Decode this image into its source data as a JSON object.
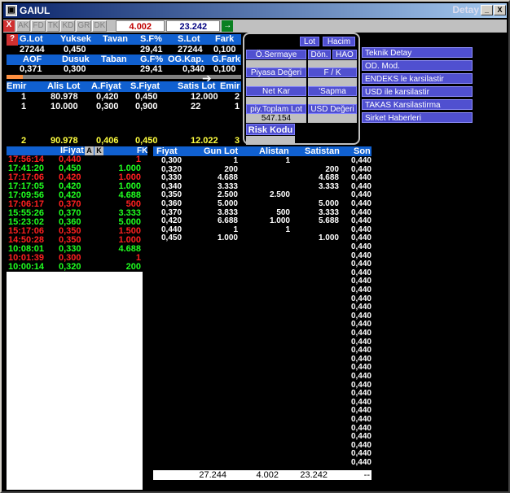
{
  "window": {
    "title": "GAIUL",
    "right_title": "Detay",
    "min": "_",
    "close": "X"
  },
  "toolbar": {
    "close": "X",
    "buttons": [
      "AK",
      "FD",
      "TK",
      "KD",
      "GR",
      "DK"
    ],
    "val1": "4.002",
    "val2": "23.242",
    "go": "→"
  },
  "h1": [
    "G.Lot",
    "Yuksek",
    "Tavan",
    "S.F%",
    "S.Lot",
    "Fark"
  ],
  "r1": [
    "27244",
    "0,450",
    "",
    "29,41",
    "27244",
    "0,100"
  ],
  "h2": [
    "AOF",
    "Dusuk",
    "Taban",
    "G.F%",
    "OG.Kap.",
    "G.Fark"
  ],
  "r2": [
    "0,371",
    "0,300",
    "",
    "29,41",
    "0,340",
    "0,100"
  ],
  "h3": [
    "Emir",
    "Alis Lot",
    "A.Fiyat",
    "S.Fiyat",
    "Satis Lot",
    "Emir"
  ],
  "orders": [
    [
      "1",
      "80.978",
      "0,420",
      "0,450",
      "12.000",
      "2"
    ],
    [
      "1",
      "10.000",
      "0,300",
      "0,900",
      "22",
      "1"
    ]
  ],
  "totals": [
    "2",
    "90.978",
    "0,406",
    "0,450",
    "12.022",
    "3"
  ],
  "popup": {
    "lot": "Lot",
    "hacim": "Hacim",
    "osermaye": "Ö.Sermaye",
    "don": "Dön.",
    "hao": "HAO",
    "piyasa": "Piyasa Değeri",
    "fk": "F / K",
    "netkar": "Net Kar",
    "sapma": "'Sapma",
    "piytoplam": "piy.Toplam Lot",
    "piytoplam_val": "547.154",
    "usd": "USD Değeri",
    "risk": "Risk Kodu"
  },
  "side": [
    "Teknik Detay",
    "OD. Mod.",
    "ENDEKS le karsilastir",
    "USD ile karsilastir",
    "TAKAS Karsilastirma",
    "Sirket Haberleri"
  ],
  "left_head": {
    "fiyat": "IFiyat",
    "a": "A",
    "k": "K",
    "fk": "FK"
  },
  "trades": [
    {
      "t": "17:56:14",
      "p": "0,440",
      "q": "1",
      "c": "red"
    },
    {
      "t": "17:41:20",
      "p": "0,450",
      "q": "1.000",
      "c": "grn"
    },
    {
      "t": "17:17:06",
      "p": "0,420",
      "q": "1.000",
      "c": "red"
    },
    {
      "t": "17:17:05",
      "p": "0,420",
      "q": "1.000",
      "c": "grn"
    },
    {
      "t": "17:09:56",
      "p": "0,420",
      "q": "4.688",
      "c": "grn"
    },
    {
      "t": "17:06:17",
      "p": "0,370",
      "q": "500",
      "c": "red"
    },
    {
      "t": "15:55:26",
      "p": "0,370",
      "q": "3.333",
      "c": "grn"
    },
    {
      "t": "15:23:02",
      "p": "0,360",
      "q": "5.000",
      "c": "grn"
    },
    {
      "t": "15:17:06",
      "p": "0,350",
      "q": "1.500",
      "c": "red"
    },
    {
      "t": "14:50:28",
      "p": "0,350",
      "q": "1.000",
      "c": "red"
    },
    {
      "t": "10:08:01",
      "p": "0,330",
      "q": "4.688",
      "c": "grn"
    },
    {
      "t": "10:01:39",
      "p": "0,300",
      "q": "1",
      "c": "red"
    },
    {
      "t": "10:00:14",
      "p": "0,320",
      "q": "200",
      "c": "grn"
    }
  ],
  "right_head": [
    "Fiyat",
    "Gun Lot",
    "Alistan",
    "Satistan",
    "Son"
  ],
  "levels": [
    [
      "0,300",
      "1",
      "1",
      ""
    ],
    [
      "0,320",
      "200",
      "",
      "200"
    ],
    [
      "0,330",
      "4.688",
      "",
      "4.688"
    ],
    [
      "0,340",
      "3.333",
      "",
      "3.333"
    ],
    [
      "0,350",
      "2.500",
      "2.500",
      ""
    ],
    [
      "0,360",
      "5.000",
      "",
      "5.000"
    ],
    [
      "0,370",
      "3.833",
      "500",
      "3.333"
    ],
    [
      "0,420",
      "6.688",
      "1.000",
      "5.688"
    ],
    [
      "0,440",
      "1",
      "1",
      ""
    ],
    [
      "0,450",
      "1.000",
      "",
      "1.000"
    ]
  ],
  "son": "0,440",
  "footer": [
    "27.244",
    "4.002",
    "23.242",
    "--"
  ]
}
